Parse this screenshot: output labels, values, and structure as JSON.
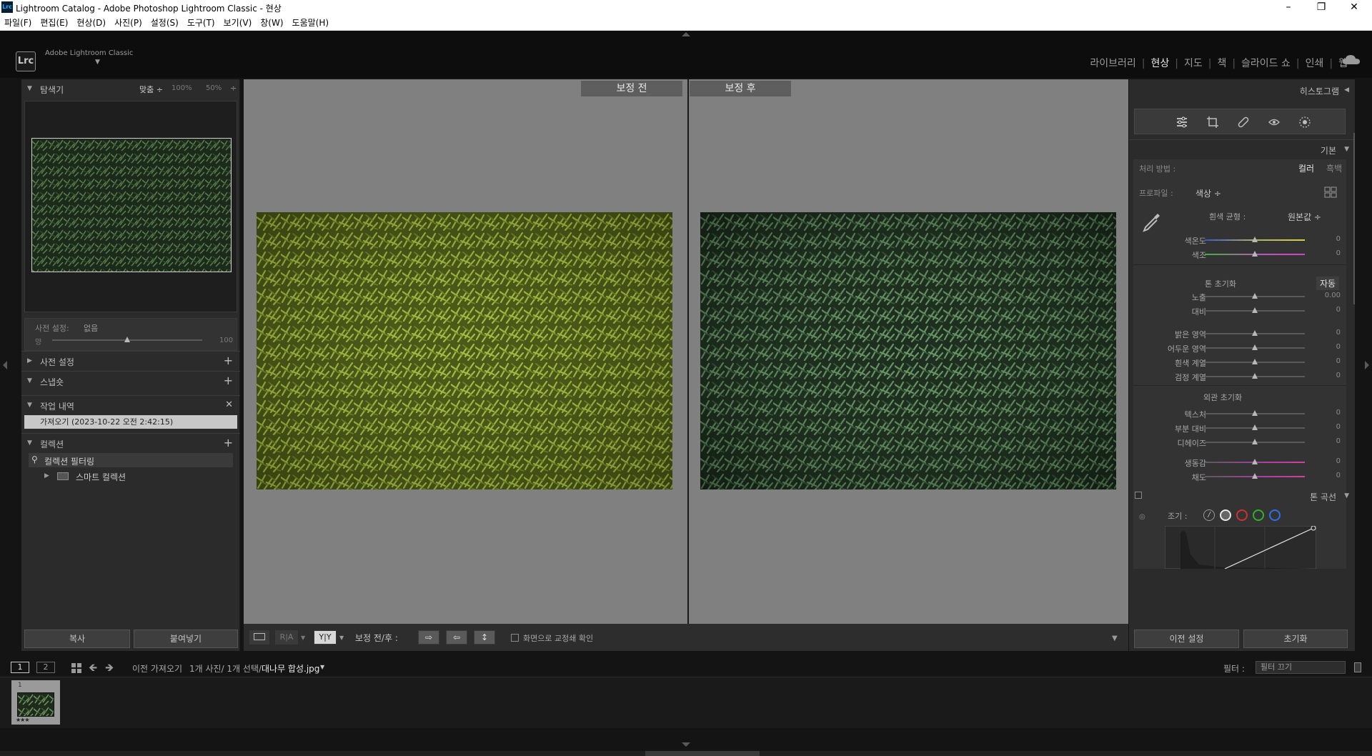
{
  "window": {
    "app_icon": "Lrc",
    "title": "Lightroom Catalog - Adobe Photoshop Lightroom Classic - 현상",
    "controls": [
      "minimize-icon",
      "restore-icon",
      "close-icon"
    ]
  },
  "menu": [
    "파일(F)",
    "편집(E)",
    "현상(D)",
    "사진(P)",
    "설정(S)",
    "도구(T)",
    "보기(V)",
    "창(W)",
    "도움말(H)"
  ],
  "identity": {
    "badge": "Lrc",
    "brand": "Adobe Lightroom Classic"
  },
  "modules": [
    {
      "label": "라이브러리",
      "active": false
    },
    {
      "label": "현상",
      "active": true
    },
    {
      "label": "지도",
      "active": false
    },
    {
      "label": "책",
      "active": false
    },
    {
      "label": "슬라이드 쇼",
      "active": false
    },
    {
      "label": "인쇄",
      "active": false
    },
    {
      "label": "웹",
      "active": false
    }
  ],
  "left": {
    "navigator": {
      "title": "탐색기",
      "zoom_fit": "맞춤 ÷",
      "zoom_100": "100%",
      "zoom_50": "50%",
      "zoom_more": "÷"
    },
    "preset_amount": {
      "label": "사전 설정:",
      "value": "없음",
      "amount_label": "양",
      "amount_value": "100",
      "amount_level": 0.5
    },
    "presets": {
      "title": "사전 설정"
    },
    "snapshots": {
      "title": "스냅숏"
    },
    "history": {
      "title": "작업 내역",
      "items": [
        "가져오기 (2023-10-22 오전 2:42:15)"
      ]
    },
    "collections": {
      "title": "컬렉션",
      "filter_label": "컬렉션 필터링",
      "items": [
        "스마트 컬렉션"
      ]
    },
    "copy_button": "복사",
    "paste_button": "붙여넣기"
  },
  "center": {
    "before_label": "보정 전",
    "after_label": "보정 후"
  },
  "toolbar": {
    "before_after_label": "보정 전/후 :",
    "ra_label": "R|A",
    "yy_label": "Y|Y",
    "proof_label": "화면으로 교정쇄 확인"
  },
  "right": {
    "histogram": {
      "title": "히스토그램"
    },
    "basic": {
      "title": "기본",
      "treatment_label": "처리 방법 :",
      "treatment_color": "컬러",
      "treatment_bw": "흑백",
      "profile_label": "프로파일 :",
      "profile_value": "색상 ÷",
      "wb_label": "흰색 균형 :",
      "wb_value": "원본값 ÷",
      "tone_label": "톤 초기화",
      "auto_label": "자동",
      "presence_label": "외관 초기화",
      "sliders": [
        {
          "label": "색온도",
          "value": "0",
          "level": 0.5
        },
        {
          "label": "색조",
          "value": "0",
          "level": 0.5
        },
        {
          "label": "노출",
          "value": "0.00",
          "level": 0.5
        },
        {
          "label": "대비",
          "value": "0",
          "level": 0.5
        },
        {
          "label": "밝은 영역",
          "value": "0",
          "level": 0.5
        },
        {
          "label": "어두운 영역",
          "value": "0",
          "level": 0.5
        },
        {
          "label": "흰색 계열",
          "value": "0",
          "level": 0.5
        },
        {
          "label": "검정 계열",
          "value": "0",
          "level": 0.5
        },
        {
          "label": "텍스처",
          "value": "0",
          "level": 0.5
        },
        {
          "label": "부분 대비",
          "value": "0",
          "level": 0.5
        },
        {
          "label": "디헤이즈",
          "value": "0",
          "level": 0.5
        },
        {
          "label": "생동감",
          "value": "0",
          "level": 0.5
        },
        {
          "label": "채도",
          "value": "0",
          "level": 0.5
        }
      ]
    },
    "tone_curve": {
      "title": "톤 곡선",
      "channel_label": "조기 :"
    },
    "prev_button": "이전 설정",
    "reset_button": "초기화"
  },
  "filmstrip": {
    "view1": "1",
    "view2": "2",
    "source": "이전 가져오기",
    "count": "1개 사진/ 1개 선택/",
    "filename": "대나무 합성.jpg",
    "filter_label": "필터 :",
    "filter_value": "필터 끄기",
    "thumb_number": "1",
    "thumb_stars": "★★★"
  },
  "colors": {
    "accent": "#e8e8e8",
    "panel": "#2b2b2b",
    "canvas": "#808080",
    "wb_temp": "#4a6ad0",
    "wb_tint": "#c040c0"
  }
}
